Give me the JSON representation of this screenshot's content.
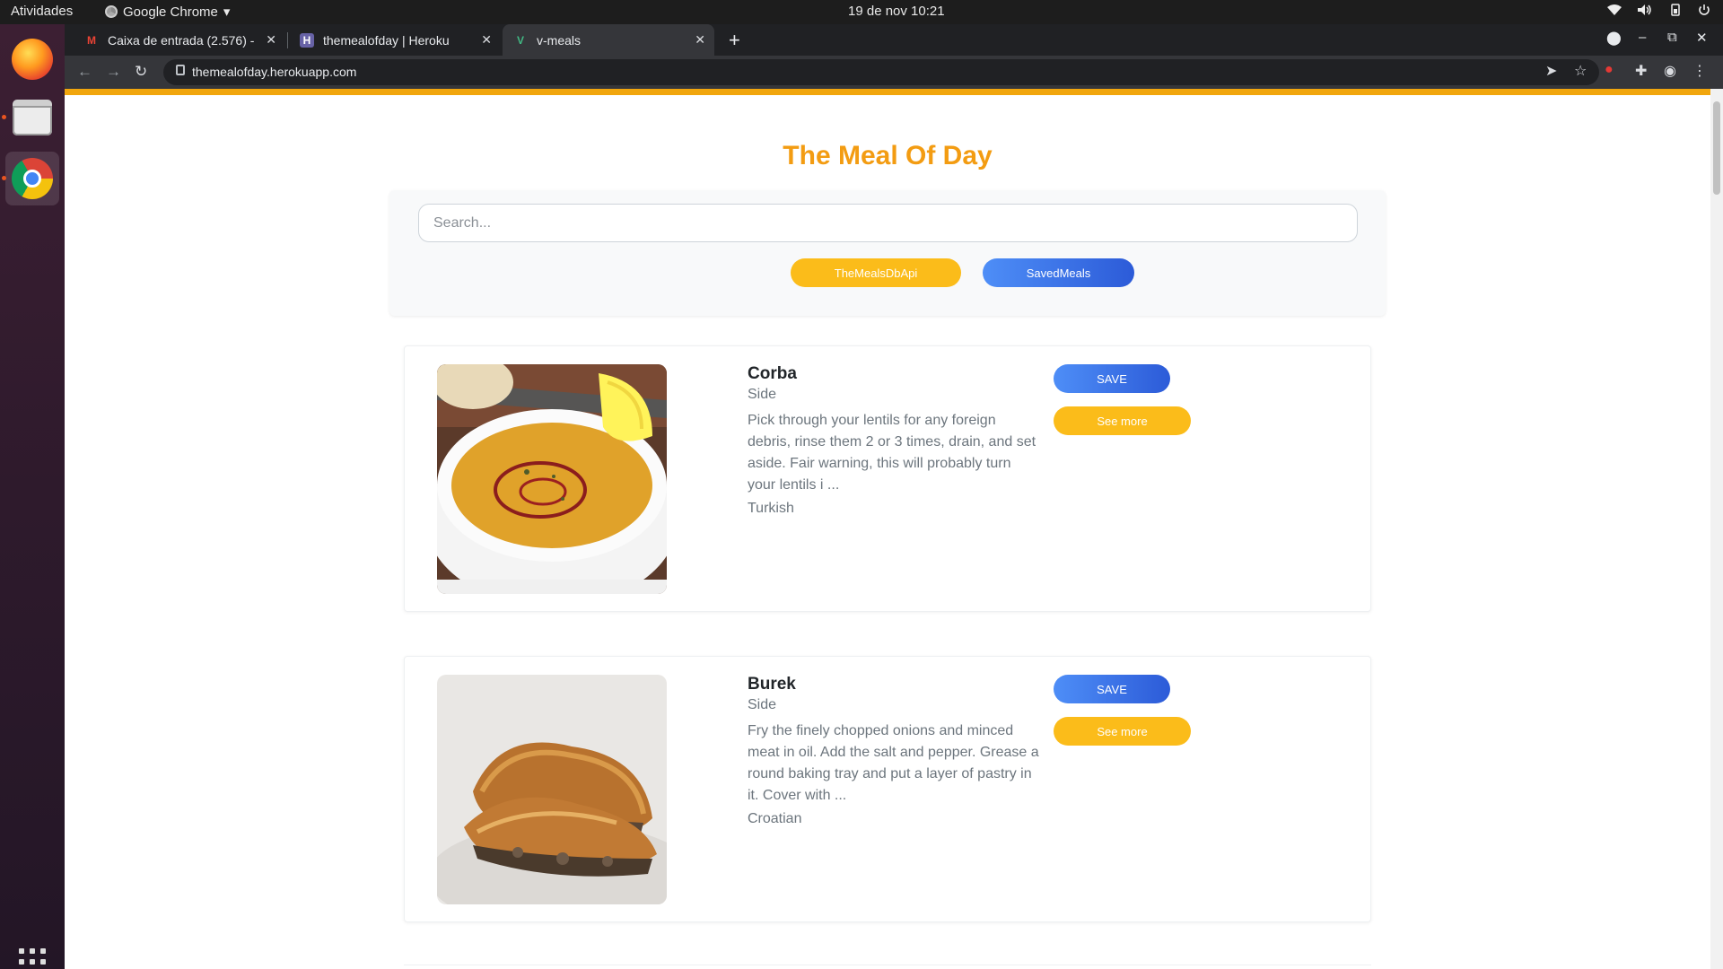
{
  "system": {
    "activities": "Atividades",
    "app_name": "Google Chrome",
    "clock": "19 de nov  10:21"
  },
  "browser": {
    "tabs": [
      {
        "label": "Caixa de entrada (2.576) -",
        "favicon": "gmail-icon"
      },
      {
        "label": "themealofday | Heroku",
        "favicon": "heroku-icon"
      },
      {
        "label": "v-meals",
        "favicon": "vue-icon"
      }
    ],
    "url": "themealofday.herokuapp.com"
  },
  "app": {
    "title": "The Meal Of Day",
    "search_placeholder": "Search...",
    "search_value": "",
    "buttons": {
      "api": "TheMealsDbApi",
      "saved": "SavedMeals"
    },
    "colors": {
      "accent_orange": "#f39c12",
      "button_orange": "#fbbc1a",
      "button_blue": "#2c5bd8"
    }
  },
  "meals": [
    {
      "name": "Corba",
      "category": "Side",
      "description": "Pick through your lentils for any foreign debris, rinse them 2 or 3 times, drain, and set aside. Fair warning, this will probably turn your lentils i ...",
      "area": "Turkish",
      "save_label": "SAVE",
      "more_label": "See more"
    },
    {
      "name": "Burek",
      "category": "Side",
      "description": "Fry the finely chopped onions and minced meat in oil. Add the salt and pepper. Grease a round baking tray and put a layer of pastry in it. Cover with ...",
      "area": "Croatian",
      "save_label": "SAVE",
      "more_label": "See more"
    }
  ]
}
